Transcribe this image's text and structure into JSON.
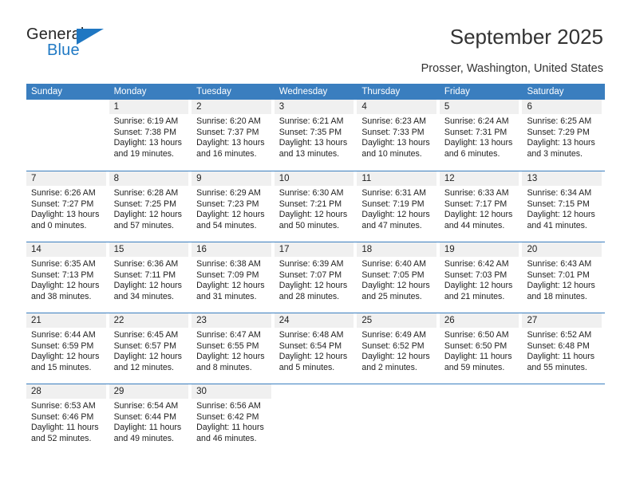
{
  "brand": {
    "name_top": "General",
    "name_bottom": "Blue",
    "triangle_icon": "blue-triangle-icon",
    "color_top": "#262626",
    "color_bottom": "#2079c4"
  },
  "header": {
    "title": "September 2025",
    "subtitle": "Prosser, Washington, United States"
  },
  "theme": {
    "header_blue": "#3a7ebf",
    "day_band_gray": "#f0f0f0",
    "text": "#222222"
  },
  "calendar": {
    "weekdays": [
      "Sunday",
      "Monday",
      "Tuesday",
      "Wednesday",
      "Thursday",
      "Friday",
      "Saturday"
    ],
    "weeks": [
      [
        {
          "day": "",
          "lines": []
        },
        {
          "day": "1",
          "lines": [
            "Sunrise: 6:19 AM",
            "Sunset: 7:38 PM",
            "Daylight: 13 hours",
            "and 19 minutes."
          ]
        },
        {
          "day": "2",
          "lines": [
            "Sunrise: 6:20 AM",
            "Sunset: 7:37 PM",
            "Daylight: 13 hours",
            "and 16 minutes."
          ]
        },
        {
          "day": "3",
          "lines": [
            "Sunrise: 6:21 AM",
            "Sunset: 7:35 PM",
            "Daylight: 13 hours",
            "and 13 minutes."
          ]
        },
        {
          "day": "4",
          "lines": [
            "Sunrise: 6:23 AM",
            "Sunset: 7:33 PM",
            "Daylight: 13 hours",
            "and 10 minutes."
          ]
        },
        {
          "day": "5",
          "lines": [
            "Sunrise: 6:24 AM",
            "Sunset: 7:31 PM",
            "Daylight: 13 hours",
            "and 6 minutes."
          ]
        },
        {
          "day": "6",
          "lines": [
            "Sunrise: 6:25 AM",
            "Sunset: 7:29 PM",
            "Daylight: 13 hours",
            "and 3 minutes."
          ]
        }
      ],
      [
        {
          "day": "7",
          "lines": [
            "Sunrise: 6:26 AM",
            "Sunset: 7:27 PM",
            "Daylight: 13 hours",
            "and 0 minutes."
          ]
        },
        {
          "day": "8",
          "lines": [
            "Sunrise: 6:28 AM",
            "Sunset: 7:25 PM",
            "Daylight: 12 hours",
            "and 57 minutes."
          ]
        },
        {
          "day": "9",
          "lines": [
            "Sunrise: 6:29 AM",
            "Sunset: 7:23 PM",
            "Daylight: 12 hours",
            "and 54 minutes."
          ]
        },
        {
          "day": "10",
          "lines": [
            "Sunrise: 6:30 AM",
            "Sunset: 7:21 PM",
            "Daylight: 12 hours",
            "and 50 minutes."
          ]
        },
        {
          "day": "11",
          "lines": [
            "Sunrise: 6:31 AM",
            "Sunset: 7:19 PM",
            "Daylight: 12 hours",
            "and 47 minutes."
          ]
        },
        {
          "day": "12",
          "lines": [
            "Sunrise: 6:33 AM",
            "Sunset: 7:17 PM",
            "Daylight: 12 hours",
            "and 44 minutes."
          ]
        },
        {
          "day": "13",
          "lines": [
            "Sunrise: 6:34 AM",
            "Sunset: 7:15 PM",
            "Daylight: 12 hours",
            "and 41 minutes."
          ]
        }
      ],
      [
        {
          "day": "14",
          "lines": [
            "Sunrise: 6:35 AM",
            "Sunset: 7:13 PM",
            "Daylight: 12 hours",
            "and 38 minutes."
          ]
        },
        {
          "day": "15",
          "lines": [
            "Sunrise: 6:36 AM",
            "Sunset: 7:11 PM",
            "Daylight: 12 hours",
            "and 34 minutes."
          ]
        },
        {
          "day": "16",
          "lines": [
            "Sunrise: 6:38 AM",
            "Sunset: 7:09 PM",
            "Daylight: 12 hours",
            "and 31 minutes."
          ]
        },
        {
          "day": "17",
          "lines": [
            "Sunrise: 6:39 AM",
            "Sunset: 7:07 PM",
            "Daylight: 12 hours",
            "and 28 minutes."
          ]
        },
        {
          "day": "18",
          "lines": [
            "Sunrise: 6:40 AM",
            "Sunset: 7:05 PM",
            "Daylight: 12 hours",
            "and 25 minutes."
          ]
        },
        {
          "day": "19",
          "lines": [
            "Sunrise: 6:42 AM",
            "Sunset: 7:03 PM",
            "Daylight: 12 hours",
            "and 21 minutes."
          ]
        },
        {
          "day": "20",
          "lines": [
            "Sunrise: 6:43 AM",
            "Sunset: 7:01 PM",
            "Daylight: 12 hours",
            "and 18 minutes."
          ]
        }
      ],
      [
        {
          "day": "21",
          "lines": [
            "Sunrise: 6:44 AM",
            "Sunset: 6:59 PM",
            "Daylight: 12 hours",
            "and 15 minutes."
          ]
        },
        {
          "day": "22",
          "lines": [
            "Sunrise: 6:45 AM",
            "Sunset: 6:57 PM",
            "Daylight: 12 hours",
            "and 12 minutes."
          ]
        },
        {
          "day": "23",
          "lines": [
            "Sunrise: 6:47 AM",
            "Sunset: 6:55 PM",
            "Daylight: 12 hours",
            "and 8 minutes."
          ]
        },
        {
          "day": "24",
          "lines": [
            "Sunrise: 6:48 AM",
            "Sunset: 6:54 PM",
            "Daylight: 12 hours",
            "and 5 minutes."
          ]
        },
        {
          "day": "25",
          "lines": [
            "Sunrise: 6:49 AM",
            "Sunset: 6:52 PM",
            "Daylight: 12 hours",
            "and 2 minutes."
          ]
        },
        {
          "day": "26",
          "lines": [
            "Sunrise: 6:50 AM",
            "Sunset: 6:50 PM",
            "Daylight: 11 hours",
            "and 59 minutes."
          ]
        },
        {
          "day": "27",
          "lines": [
            "Sunrise: 6:52 AM",
            "Sunset: 6:48 PM",
            "Daylight: 11 hours",
            "and 55 minutes."
          ]
        }
      ],
      [
        {
          "day": "28",
          "lines": [
            "Sunrise: 6:53 AM",
            "Sunset: 6:46 PM",
            "Daylight: 11 hours",
            "and 52 minutes."
          ]
        },
        {
          "day": "29",
          "lines": [
            "Sunrise: 6:54 AM",
            "Sunset: 6:44 PM",
            "Daylight: 11 hours",
            "and 49 minutes."
          ]
        },
        {
          "day": "30",
          "lines": [
            "Sunrise: 6:56 AM",
            "Sunset: 6:42 PM",
            "Daylight: 11 hours",
            "and 46 minutes."
          ]
        },
        {
          "day": "",
          "lines": []
        },
        {
          "day": "",
          "lines": []
        },
        {
          "day": "",
          "lines": []
        },
        {
          "day": "",
          "lines": []
        }
      ]
    ]
  }
}
